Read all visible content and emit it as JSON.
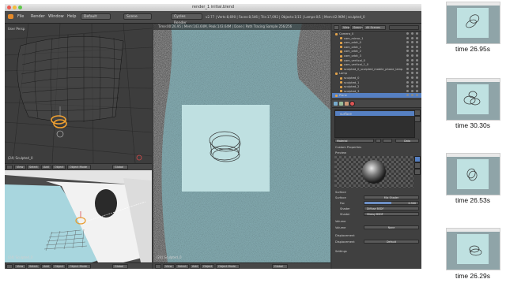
{
  "window": {
    "title": "render_1 initial.blend",
    "menu": [
      "File",
      "Render",
      "Window",
      "Help"
    ],
    "layout_chip": "Default",
    "scene_chip": "Scene",
    "engine_chip": "Cycles Render",
    "stats": "v2.77 | Verts:8,690 | Faces:8,546 | Tris:17,092 | Objects:1/15 | Lamps:0/1 | Mem:42.96M | sculpted_0",
    "render_info": "Time:00:26.95 | Mem:143.64M, Peak:143.64M | Done | Path Tracing Sample 256/256"
  },
  "viewport_top_left": {
    "label": "User Persp",
    "object_label": "(24) Sculpted_0",
    "header_buttons": [
      "View",
      "Select",
      "Add",
      "Object",
      "Object Mode",
      "Global"
    ]
  },
  "viewport_bottom_left": {
    "object_label": "(24) Sculpted_0",
    "header_buttons": [
      "View",
      "Select",
      "Add",
      "Object",
      "Object Mode",
      "Global"
    ]
  },
  "viewport_center": {
    "object_label": "(24) Sculpted_0",
    "header_buttons": [
      "View",
      "Select",
      "Add",
      "Object",
      "Object Mode",
      "Global"
    ]
  },
  "outliner": {
    "view_chip": "View",
    "search_chip": "Search",
    "all_scenes": "All Scenes",
    "rows": [
      "Camera_0",
      "cam_mirror_1",
      "cam_orbit_0",
      "cam_orbit_1",
      "cam_orbit_2",
      "cam_orbit_3",
      "cam_vertical_0",
      "cam_vertical_1_0",
      "sculpted_0_sculpted_mobile_phone_lamp",
      "Lamp",
      "sculpted_0",
      "sculpted_1",
      "sculpted_2",
      "sculpted_3",
      "Plane"
    ]
  },
  "properties": {
    "material_slot": "surface",
    "material_name": "Material",
    "preview_heading": "Preview",
    "surface_heading": "Surface",
    "surface_label": "Surface",
    "surface_value": "Mix Shader",
    "fac_label": "Fac",
    "fac_value": "0.500",
    "shader1_label": "Shader",
    "shader1_value": "Diffuse BSDF",
    "shader2_label": "Shader",
    "shader2_value": "Glossy BSDF",
    "volume_heading": "Volume",
    "volume_label": "Volume",
    "volume_value": "None",
    "displacement_heading": "Displacement",
    "displacement_label": "Displacement",
    "displacement_value": "Default",
    "settings_heading": "Settings",
    "data_chip": "Data",
    "custom_props": "Custom Properties"
  },
  "thumbnails": [
    {
      "caption": "time 26.95s"
    },
    {
      "caption": "time 30.30s"
    },
    {
      "caption": "time 26.53s"
    },
    {
      "caption": "time 26.29s"
    }
  ],
  "colors": {
    "blender_bg": "#3a3a3a",
    "viewport_grid": "#333333",
    "render_cyan": "#8db6bc",
    "render_paper": "#bfe0e1",
    "selection_orange": "#e89a2a",
    "selected_row_blue": "#5680c2"
  }
}
